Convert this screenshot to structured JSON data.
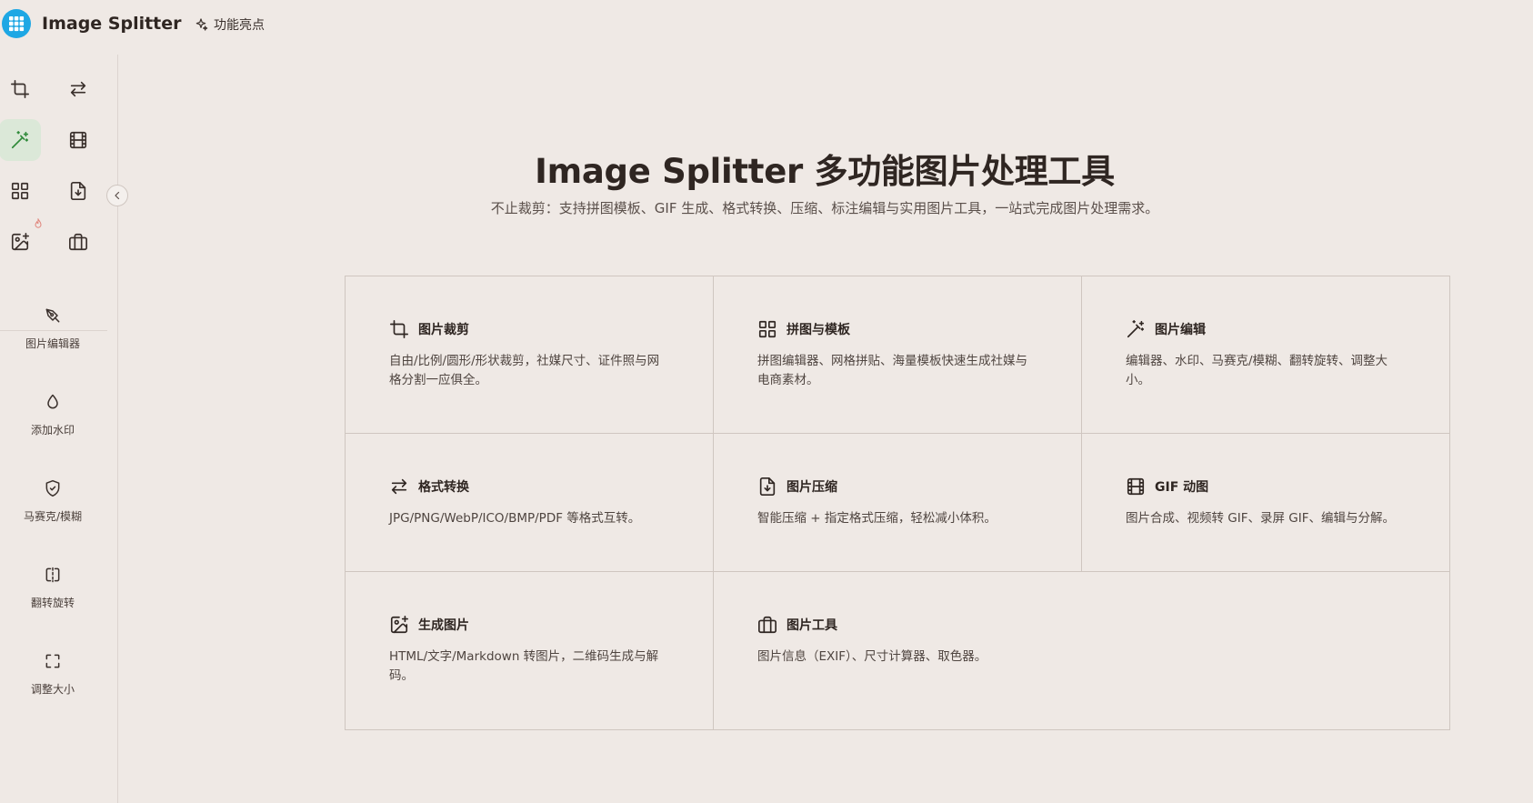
{
  "header": {
    "app_name": "Image Splitter",
    "highlights_label": "功能亮点",
    "logo_color": "#1ea7e4"
  },
  "sidebar": {
    "icon_grid": [
      {
        "icon": "crop-icon",
        "active": false
      },
      {
        "icon": "swap-arrows-icon",
        "active": false
      },
      {
        "icon": "magic-wand-icon",
        "active": true
      },
      {
        "icon": "film-icon",
        "active": false
      },
      {
        "icon": "grid-icon",
        "active": false
      },
      {
        "icon": "file-download-icon",
        "active": false
      },
      {
        "icon": "image-plus-icon",
        "active": false
      },
      {
        "icon": "briefcase-icon",
        "active": false
      }
    ],
    "tools": [
      {
        "label": "图片编辑器",
        "icon": "pen-nib-icon"
      },
      {
        "label": "添加水印",
        "icon": "droplet-icon"
      },
      {
        "label": "马赛克/模糊",
        "icon": "shield-icon"
      },
      {
        "label": "翻转旋转",
        "icon": "flip-icon"
      },
      {
        "label": "调整大小",
        "icon": "resize-icon"
      }
    ]
  },
  "hero": {
    "title": "Image Splitter 多功能图片处理工具",
    "subtitle": "不止裁剪：支持拼图模板、GIF 生成、格式转换、压缩、标注编辑与实用图片工具，一站式完成图片处理需求。"
  },
  "features": [
    {
      "title": "图片裁剪",
      "icon": "crop-icon",
      "desc": "自由/比例/圆形/形状裁剪，社媒尺寸、证件照与网格分割一应俱全。"
    },
    {
      "title": "拼图与模板",
      "icon": "grid-icon",
      "desc": "拼图编辑器、网格拼贴、海量模板快速生成社媒与电商素材。"
    },
    {
      "title": "图片编辑",
      "icon": "magic-wand-icon",
      "desc": "编辑器、水印、马赛克/模糊、翻转旋转、调整大小。"
    },
    {
      "title": "格式转换",
      "icon": "swap-arrows-icon",
      "desc": "JPG/PNG/WebP/ICO/BMP/PDF 等格式互转。"
    },
    {
      "title": "图片压缩",
      "icon": "file-download-icon",
      "desc": "智能压缩 + 指定格式压缩，轻松减小体积。"
    },
    {
      "title": "GIF 动图",
      "icon": "film-icon",
      "desc": "图片合成、视频转 GIF、录屏 GIF、编辑与分解。"
    },
    {
      "title": "生成图片",
      "icon": "image-plus-icon",
      "desc": "HTML/文字/Markdown 转图片，二维码生成与解码。"
    },
    {
      "title": "图片工具",
      "icon": "briefcase-icon",
      "desc": "图片信息（EXIF）、尺寸计算器、取色器。"
    }
  ]
}
